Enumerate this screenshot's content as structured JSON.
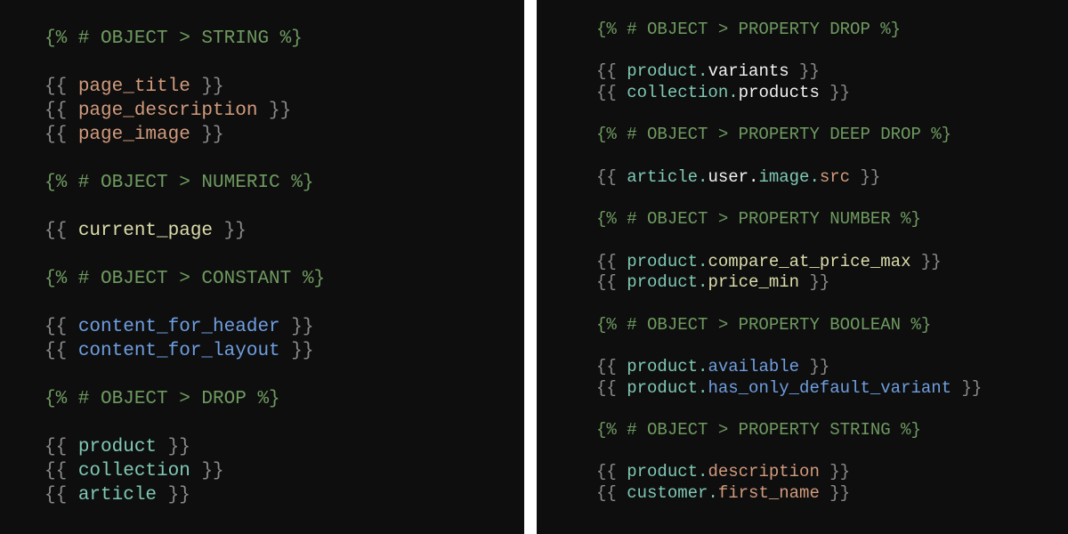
{
  "colors": {
    "background": "#0e0e0f",
    "divider": "#ffffff",
    "comment": "#6e9a5f",
    "punct": "#8a8a8a",
    "string_var": "#d29b7c",
    "numeric_var": "#dcdcaa",
    "constant_var": "#6f9fe0",
    "object_var": "#7fc9b4",
    "property_plain": "#f2f2f2"
  },
  "left_panel": {
    "lines": [
      [
        {
          "t": "{% # OBJECT > STRING %}",
          "c": "comment"
        }
      ],
      [],
      [
        {
          "t": "{{ ",
          "c": "punct"
        },
        {
          "t": "page_title",
          "c": "string_var"
        },
        {
          "t": " }}",
          "c": "punct"
        }
      ],
      [
        {
          "t": "{{ ",
          "c": "punct"
        },
        {
          "t": "page_description",
          "c": "string_var"
        },
        {
          "t": " }}",
          "c": "punct"
        }
      ],
      [
        {
          "t": "{{ ",
          "c": "punct"
        },
        {
          "t": "page_image",
          "c": "string_var"
        },
        {
          "t": " }}",
          "c": "punct"
        }
      ],
      [],
      [
        {
          "t": "{% # OBJECT > NUMERIC %}",
          "c": "comment"
        }
      ],
      [],
      [
        {
          "t": "{{ ",
          "c": "punct"
        },
        {
          "t": "current_page",
          "c": "numeric_var"
        },
        {
          "t": " }}",
          "c": "punct"
        }
      ],
      [],
      [
        {
          "t": "{% # OBJECT > CONSTANT %}",
          "c": "comment"
        }
      ],
      [],
      [
        {
          "t": "{{ ",
          "c": "punct"
        },
        {
          "t": "content_for_header",
          "c": "constant_var"
        },
        {
          "t": " }}",
          "c": "punct"
        }
      ],
      [
        {
          "t": "{{ ",
          "c": "punct"
        },
        {
          "t": "content_for_layout",
          "c": "constant_var"
        },
        {
          "t": " }}",
          "c": "punct"
        }
      ],
      [],
      [
        {
          "t": "{% # OBJECT > DROP %}",
          "c": "comment"
        }
      ],
      [],
      [
        {
          "t": "{{ ",
          "c": "punct"
        },
        {
          "t": "product",
          "c": "object_var"
        },
        {
          "t": " }}",
          "c": "punct"
        }
      ],
      [
        {
          "t": "{{ ",
          "c": "punct"
        },
        {
          "t": "collection",
          "c": "object_var"
        },
        {
          "t": " }}",
          "c": "punct"
        }
      ],
      [
        {
          "t": "{{ ",
          "c": "punct"
        },
        {
          "t": "article",
          "c": "object_var"
        },
        {
          "t": " }}",
          "c": "punct"
        }
      ]
    ]
  },
  "right_panel": {
    "lines": [
      [
        {
          "t": "{% # OBJECT > PROPERTY DROP %}",
          "c": "comment"
        }
      ],
      [],
      [
        {
          "t": "{{ ",
          "c": "punct"
        },
        {
          "t": "product.",
          "c": "object_var"
        },
        {
          "t": "variants",
          "c": "property_plain"
        },
        {
          "t": " }}",
          "c": "punct"
        }
      ],
      [
        {
          "t": "{{ ",
          "c": "punct"
        },
        {
          "t": "collection.",
          "c": "object_var"
        },
        {
          "t": "products",
          "c": "property_plain"
        },
        {
          "t": " }}",
          "c": "punct"
        }
      ],
      [],
      [
        {
          "t": "{% # OBJECT > PROPERTY DEEP DROP %}",
          "c": "comment"
        }
      ],
      [],
      [
        {
          "t": "{{ ",
          "c": "punct"
        },
        {
          "t": "article.",
          "c": "object_var"
        },
        {
          "t": "user.",
          "c": "property_plain"
        },
        {
          "t": "image.",
          "c": "object_var"
        },
        {
          "t": "src",
          "c": "string_var"
        },
        {
          "t": " }}",
          "c": "punct"
        }
      ],
      [],
      [
        {
          "t": "{% # OBJECT > PROPERTY NUMBER %}",
          "c": "comment"
        }
      ],
      [],
      [
        {
          "t": "{{ ",
          "c": "punct"
        },
        {
          "t": "product.",
          "c": "object_var"
        },
        {
          "t": "compare_at_price_max",
          "c": "numeric_var"
        },
        {
          "t": " }}",
          "c": "punct"
        }
      ],
      [
        {
          "t": "{{ ",
          "c": "punct"
        },
        {
          "t": "product.",
          "c": "object_var"
        },
        {
          "t": "price_min",
          "c": "numeric_var"
        },
        {
          "t": " }}",
          "c": "punct"
        }
      ],
      [],
      [
        {
          "t": "{% # OBJECT > PROPERTY BOOLEAN %}",
          "c": "comment"
        }
      ],
      [],
      [
        {
          "t": "{{ ",
          "c": "punct"
        },
        {
          "t": "product.",
          "c": "object_var"
        },
        {
          "t": "available",
          "c": "constant_var"
        },
        {
          "t": " }}",
          "c": "punct"
        }
      ],
      [
        {
          "t": "{{ ",
          "c": "punct"
        },
        {
          "t": "product.",
          "c": "object_var"
        },
        {
          "t": "has_only_default_variant",
          "c": "constant_var"
        },
        {
          "t": " }}",
          "c": "punct"
        }
      ],
      [],
      [
        {
          "t": "{% # OBJECT > PROPERTY STRING %}",
          "c": "comment"
        }
      ],
      [],
      [
        {
          "t": "{{ ",
          "c": "punct"
        },
        {
          "t": "product.",
          "c": "object_var"
        },
        {
          "t": "description",
          "c": "string_var"
        },
        {
          "t": " }}",
          "c": "punct"
        }
      ],
      [
        {
          "t": "{{ ",
          "c": "punct"
        },
        {
          "t": "customer.",
          "c": "object_var"
        },
        {
          "t": "first_name",
          "c": "string_var"
        },
        {
          "t": " }}",
          "c": "punct"
        }
      ]
    ]
  }
}
